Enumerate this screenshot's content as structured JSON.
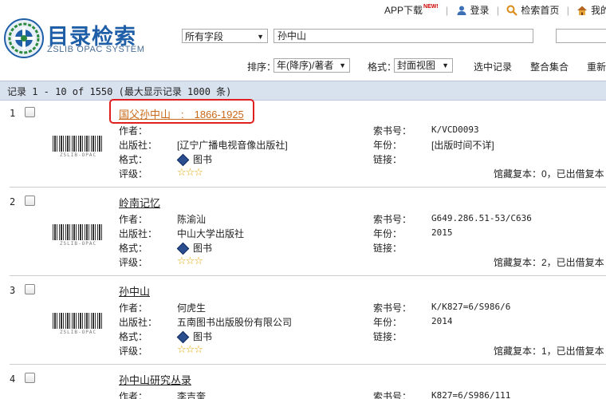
{
  "header": {
    "app_download": "APP下载",
    "new_badge": "NEW!",
    "login": "登录",
    "search_home": "检索首页",
    "my_library": "我的图书"
  },
  "logo": {
    "title": "目录检索",
    "subtitle": "ZSLIB OPAC SYSTEM"
  },
  "search": {
    "field": "所有字段",
    "query": "孙中山"
  },
  "toolbar": {
    "sort_label": "排序：",
    "sort_value": "年(降序)/著者",
    "format_label": "格式：",
    "format_value": "封面视图",
    "select_records": "选中记录",
    "merge_set": "整合集合",
    "refresh": "重新"
  },
  "records_header": "记录 1 - 10 of 1550 (最大显示记录 1000 条)",
  "barcode_label": "ZSLIB-OPAC",
  "field_labels": {
    "author": "作者：",
    "publisher": "出版社：",
    "format": "格式：",
    "rating": "评级：",
    "call_no": "索书号：",
    "year": "年份：",
    "link": "链接："
  },
  "records": [
    {
      "num": "1",
      "title": "国父孙中山　:　1866-1925",
      "author": "",
      "publisher": "[辽宁广播电视音像出版社]",
      "format": "图书",
      "rating": "☆☆☆",
      "call_no": "K/VCD0093",
      "year": "[出版时间不详]",
      "holdings": "馆藏复本：0，已出借复本"
    },
    {
      "num": "2",
      "title": "岭南记忆",
      "author": "陈渝汕",
      "publisher": "中山大学出版社",
      "format": "图书",
      "rating": "☆☆☆",
      "call_no": "G649.286.51-53/C636",
      "year": "2015",
      "holdings": "馆藏复本：2，已出借复本"
    },
    {
      "num": "3",
      "title": "孙中山",
      "author": "何虎生",
      "publisher": "五南图书出版股份有限公司",
      "format": "图书",
      "rating": "☆☆☆",
      "call_no": "K/K827=6/S986/6",
      "year": "2014",
      "holdings": "馆藏复本：1，已出借复本"
    },
    {
      "num": "4",
      "title": "孙中山研究丛录",
      "author": "李吉奎",
      "call_no": "K827=6/S986/111"
    }
  ]
}
